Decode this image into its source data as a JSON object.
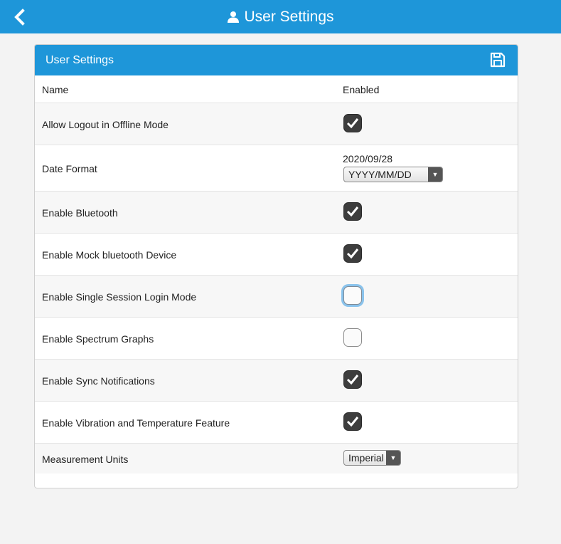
{
  "app": {
    "title": "User Settings",
    "colors": {
      "accent": "#1e96d9",
      "checkbox_on": "#3d3d3d",
      "focus_ring": "#8ac3ec"
    }
  },
  "panel": {
    "title": "User Settings",
    "columns": {
      "name": "Name",
      "enabled": "Enabled"
    },
    "settings": [
      {
        "label": "Allow Logout in Offline Mode",
        "checked": true
      },
      {
        "label": "Date Format",
        "preview": "2020/09/28",
        "selected": "YYYY/MM/DD"
      },
      {
        "label": "Enable Bluetooth",
        "checked": true
      },
      {
        "label": "Enable Mock bluetooth Device",
        "checked": true
      },
      {
        "label": "Enable Single Session Login Mode",
        "checked": false,
        "focused": true
      },
      {
        "label": "Enable Spectrum Graphs",
        "checked": false
      },
      {
        "label": "Enable Sync Notifications",
        "checked": true
      },
      {
        "label": "Enable Vibration and Temperature Feature",
        "checked": true
      },
      {
        "label": "Measurement Units",
        "selected": "Imperial"
      }
    ]
  }
}
